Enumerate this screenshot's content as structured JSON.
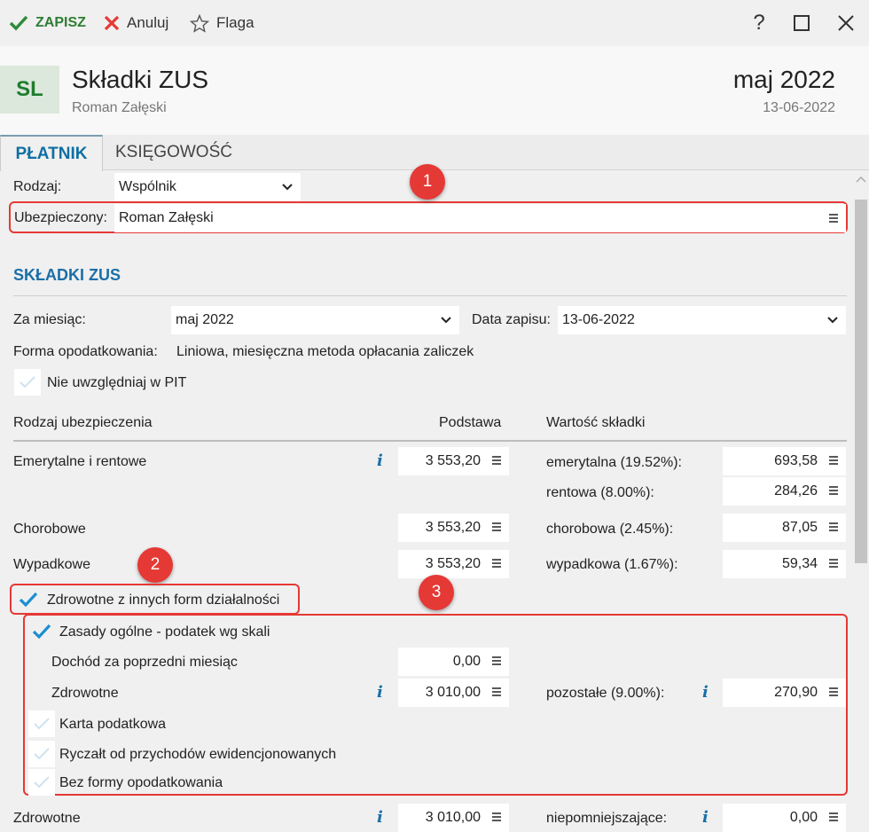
{
  "toolbar": {
    "save": "ZAPISZ",
    "cancel": "Anuluj",
    "flag": "Flaga"
  },
  "header": {
    "avatar": "SL",
    "title": "Składki ZUS",
    "subtitle": "Roman Załęski",
    "period": "maj 2022",
    "date": "13-06-2022"
  },
  "tabs": {
    "payer": "PŁATNIK",
    "accounting": "KSIĘGOWOŚĆ"
  },
  "form": {
    "kind_label": "Rodzaj:",
    "kind_value": "Wspólnik",
    "insured_label": "Ubezpieczony:",
    "insured_value": "Roman Załęski"
  },
  "section": {
    "title": "SKŁADKI ZUS"
  },
  "month": {
    "label": "Za miesiąc:",
    "value": "maj 2022",
    "date_label": "Data zapisu:",
    "date_value": "13-06-2022"
  },
  "tax_form": {
    "label": "Forma opodatkowania:",
    "value": "Liniowa, miesięczna metoda opłacania zaliczek"
  },
  "exclude_pit": {
    "label": "Nie uwzględniaj w PIT"
  },
  "columns": {
    "type": "Rodzaj ubezpieczenia",
    "base": "Podstawa",
    "value": "Wartość składki"
  },
  "rows": {
    "pension": {
      "label": "Emerytalne i rentowe",
      "base": "3 553,20",
      "sub1_label": "emerytalna (19.52%):",
      "sub1_value": "693,58",
      "sub2_label": "rentowa (8.00%):",
      "sub2_value": "284,26"
    },
    "sickness": {
      "label": "Chorobowe",
      "base": "3 553,20",
      "sub_label": "chorobowa (2.45%):",
      "sub_value": "87,05"
    },
    "accident": {
      "label": "Wypadkowe",
      "base": "3 553,20",
      "sub_label": "wypadkowa (1.67%):",
      "sub_value": "59,34"
    }
  },
  "health_other": {
    "label": "Zdrowotne z innych form działalności"
  },
  "general": {
    "label": "Zasady ogólne - podatek wg skali",
    "prev_income_label": "Dochód za poprzedni miesiąc",
    "prev_income": "0,00",
    "health_label": "Zdrowotne",
    "health_base": "3 010,00",
    "other_label": "pozostałe (9.00%):",
    "other_value": "270,90"
  },
  "options": {
    "card": "Karta podatkowa",
    "lump": "Ryczałt od przychodów ewidencjonowanych",
    "none": "Bez formy opodatkowania"
  },
  "health": {
    "label": "Zdrowotne",
    "base": "3 010,00",
    "sub_label": "niepomniejszające:",
    "sub_value": "0,00"
  },
  "badges": {
    "b1": "1",
    "b2": "2",
    "b3": "3"
  },
  "colors": {
    "accent": "#1a6fa8",
    "save": "#2e7d32",
    "cancel": "#e53935",
    "highlight": "#e53935"
  }
}
